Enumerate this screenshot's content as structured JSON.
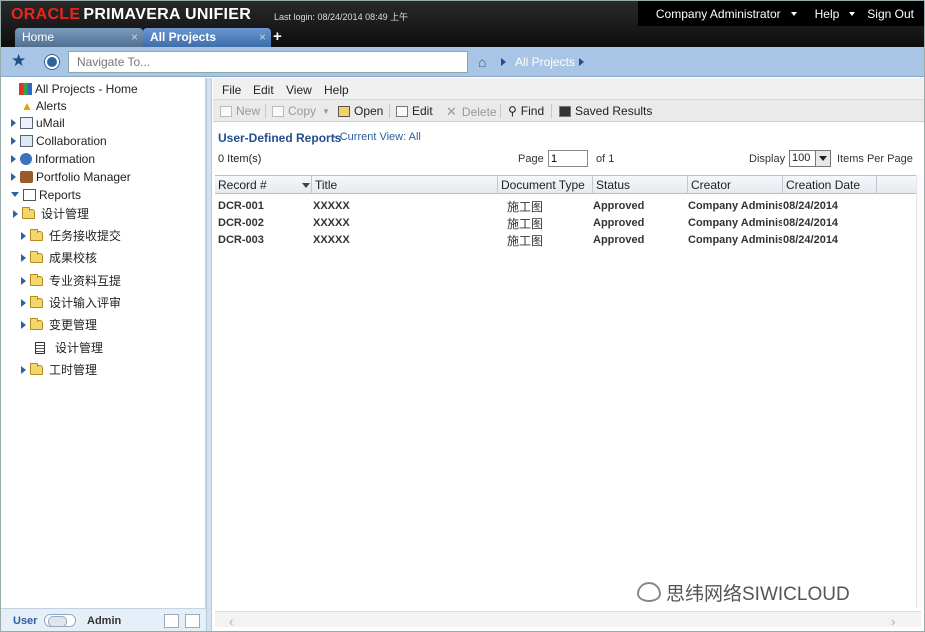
{
  "header": {
    "logo_oracle": "ORACLE",
    "logo_product": "PRIMAVERA UNIFIER",
    "last_login": "Last login: 08/24/2014 08:49 上午",
    "user_menu": "Company Administrator",
    "help": "Help",
    "sign_out": "Sign Out"
  },
  "tabs": [
    {
      "label": "Home"
    },
    {
      "label": "All Projects"
    }
  ],
  "tab_close": "×",
  "tab_add": "+",
  "nav": {
    "placeholder": "Navigate To...",
    "breadcrumb": "All Projects"
  },
  "sidebar": {
    "items": [
      {
        "label": "All Projects - Home"
      },
      {
        "label": "Alerts"
      },
      {
        "label": "uMail"
      },
      {
        "label": "Collaboration"
      },
      {
        "label": "Information"
      },
      {
        "label": "Portfolio Manager"
      },
      {
        "label": "Reports"
      },
      {
        "label": "设计管理"
      },
      {
        "label": "任务接收提交"
      },
      {
        "label": "成果校核"
      },
      {
        "label": "专业资料互提"
      },
      {
        "label": "设计输入评审"
      },
      {
        "label": "变更管理"
      },
      {
        "label": "设计管理"
      },
      {
        "label": "工时管理"
      }
    ],
    "footer": {
      "user": "User",
      "admin": "Admin"
    }
  },
  "menu": [
    "File",
    "Edit",
    "View",
    "Help"
  ],
  "toolbar": {
    "new": "New",
    "copy": "Copy",
    "open": "Open",
    "edit": "Edit",
    "delete": "Delete",
    "find": "Find",
    "saved": "Saved Results"
  },
  "report": {
    "title": "User-Defined Reports",
    "current_view": "- Current View:  All",
    "items": "0  Item(s)",
    "page_label": "Page",
    "page_value": "1",
    "page_of": "of  1",
    "display_label": "Display",
    "display_value": "100",
    "per_page": "Items Per Page"
  },
  "table": {
    "columns": [
      "Record #",
      "Title",
      "Document Type",
      "Status",
      "Creator",
      "Creation Date"
    ],
    "rows": [
      {
        "record": "DCR-001",
        "title": "XXXXX",
        "type": "施工图",
        "status": "Approved",
        "creator": "Company Administ",
        "date": "08/24/2014"
      },
      {
        "record": "DCR-002",
        "title": "XXXXX",
        "type": "施工图",
        "status": "Approved",
        "creator": "Company Administ",
        "date": "08/24/2014"
      },
      {
        "record": "DCR-003",
        "title": "XXXXX",
        "type": "施工图",
        "status": "Approved",
        "creator": "Company Administ",
        "date": "08/24/2014"
      }
    ]
  },
  "watermark": "思纬网络SIWICLOUD",
  "colors": {
    "oracle_red": "#e8251e",
    "navbar": "#a9c5e6",
    "link": "#1f4f8f"
  }
}
